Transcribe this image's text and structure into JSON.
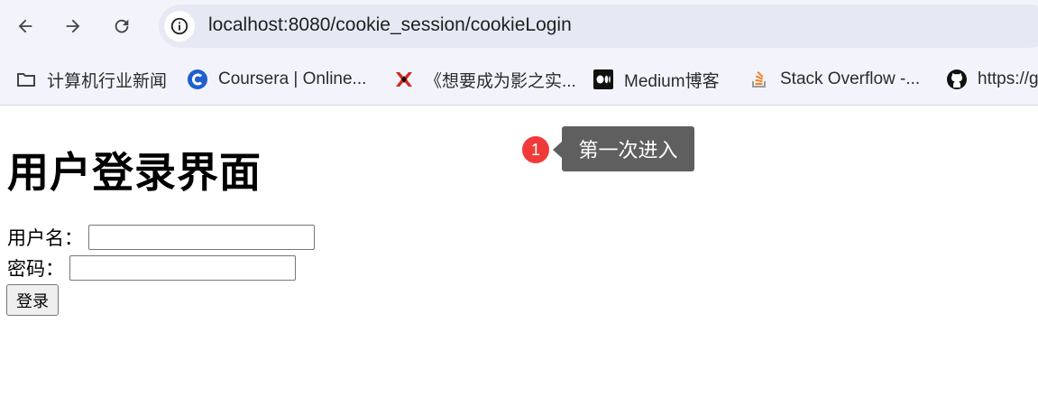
{
  "browser": {
    "url": "localhost:8080/cookie_session/cookieLogin",
    "bookmarks": [
      {
        "label": "计算机行业新闻",
        "icon": "folder-icon"
      },
      {
        "label": "Coursera | Online...",
        "icon": "coursera-icon"
      },
      {
        "label": "《想要成为影之实...",
        "icon": "bookmark-site-icon"
      },
      {
        "label": "Medium博客",
        "icon": "medium-icon"
      },
      {
        "label": "Stack Overflow -...",
        "icon": "stackoverflow-icon"
      },
      {
        "label": "https://g",
        "icon": "github-icon"
      }
    ]
  },
  "page": {
    "title": "用户登录界面",
    "username_label": "用户名：",
    "username_value": "",
    "password_label": "密码：",
    "password_value": "",
    "login_button": "登录"
  },
  "annotation": {
    "badge": "1",
    "tooltip": "第一次进入"
  },
  "colors": {
    "badge": "#f03a3a",
    "tooltip_bg": "#5f5f5f",
    "chrome_bg": "#f3f4fb",
    "omnibox_bg": "#e6e9f4"
  }
}
